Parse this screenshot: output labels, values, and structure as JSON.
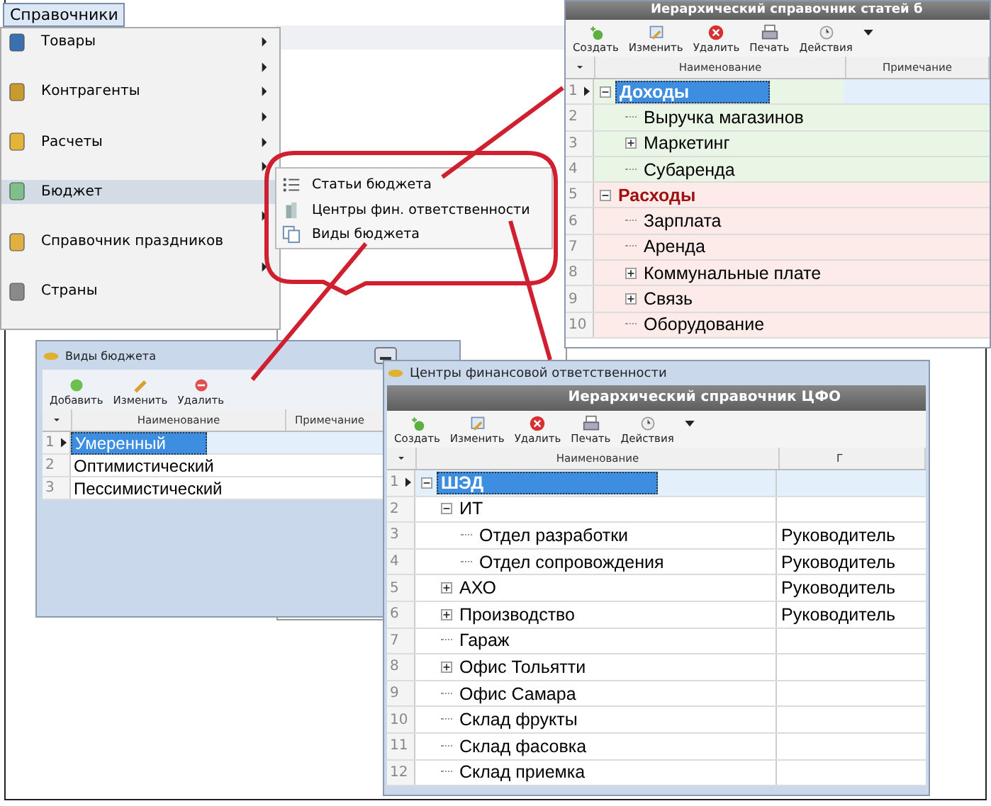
{
  "menu_button": {
    "label": "Справочники"
  },
  "menu": {
    "items": [
      {
        "kind": "goods",
        "label": "Товары",
        "submenu": true,
        "selected": false
      },
      {
        "kind": "blank",
        "submenu": true,
        "selected": false
      },
      {
        "kind": "partners",
        "label": "Контрагенты",
        "submenu": true,
        "selected": false
      },
      {
        "kind": "blank",
        "submenu": true,
        "selected": false
      },
      {
        "kind": "payments",
        "label": "Расчеты",
        "submenu": true,
        "selected": false
      },
      {
        "kind": "blank",
        "submenu": true,
        "selected": false
      },
      {
        "kind": "budget",
        "label": "Бюджет",
        "submenu": false,
        "selected": true
      },
      {
        "kind": "blank",
        "submenu": true,
        "selected": false
      },
      {
        "kind": "holidays",
        "label": "Справочник праздников",
        "submenu": false,
        "selected": false
      },
      {
        "kind": "blank",
        "submenu": true,
        "selected": false
      },
      {
        "kind": "countries",
        "label": "Страны",
        "submenu": false,
        "selected": false
      }
    ]
  },
  "submenu": {
    "items": [
      {
        "kind": "list",
        "label": "Статьи бюджета"
      },
      {
        "kind": "building",
        "label": "Центры фин. ответственности"
      },
      {
        "kind": "pages",
        "label": "Виды бюджета"
      }
    ]
  },
  "articles_window": {
    "title": "Иерархический справочник статей б",
    "toolbar": [
      {
        "kind": "add",
        "label": "Создать"
      },
      {
        "kind": "edit",
        "label": "Изменить"
      },
      {
        "kind": "delete",
        "label": "Удалить"
      },
      {
        "kind": "print",
        "label": "Печать"
      },
      {
        "kind": "actions",
        "label": "Действия"
      }
    ],
    "columns": [
      "Наименование",
      "Примечание"
    ],
    "rows": [
      {
        "num": "1",
        "name": "Доходы",
        "color": "#e9f6e6",
        "selected": true,
        "expanded": true,
        "children": [
          {
            "num": "2",
            "name": "Выручка магазинов",
            "color": "#e9f6e6",
            "selected": false
          },
          {
            "num": "3",
            "name": "Маркетинг",
            "color": "#e9f6e6",
            "selected": false,
            "expanded": false
          },
          {
            "num": "4",
            "name": "Субаренда",
            "color": "#e9f6e6",
            "selected": false
          }
        ]
      },
      {
        "num": "5",
        "name": "Расходы",
        "color": "#fcebe8",
        "selected": false,
        "expanded": true,
        "children": [
          {
            "num": "6",
            "name": "Зарплата",
            "color": "#fcebe8",
            "selected": false
          },
          {
            "num": "7",
            "name": "Аренда",
            "color": "#fcebe8",
            "selected": false
          },
          {
            "num": "8",
            "name": "Коммунальные плате",
            "color": "#fcebe8",
            "selected": false,
            "expanded": false
          },
          {
            "num": "9",
            "name": "Связь",
            "color": "#fcebe8",
            "selected": false,
            "expanded": false
          },
          {
            "num": "10",
            "name": "Оборудование",
            "color": "#fcebe8",
            "selected": false
          }
        ]
      }
    ]
  },
  "budget_types_window": {
    "title": "Виды бюджета",
    "toolbar": [
      {
        "kind": "add",
        "label": "Добавить"
      },
      {
        "kind": "edit",
        "label": "Изменить"
      },
      {
        "kind": "delete",
        "label": "Удалить"
      }
    ],
    "columns": [
      "Наименование",
      "Примечание"
    ],
    "rows": [
      {
        "num": "1",
        "name": "Умеренный",
        "selected": true
      },
      {
        "num": "2",
        "name": "Оптимистический",
        "selected": false
      },
      {
        "num": "3",
        "name": "Пессимистический",
        "selected": false
      }
    ]
  },
  "cfo_window": {
    "title": "Центры финансовой ответственности",
    "heading": "Иерархический справочник ЦФО",
    "toolbar": [
      {
        "kind": "add",
        "label": "Создать"
      },
      {
        "kind": "edit",
        "label": "Изменить"
      },
      {
        "kind": "delete",
        "label": "Удалить"
      },
      {
        "kind": "print",
        "label": "Печать"
      },
      {
        "kind": "actions",
        "label": "Действия"
      }
    ],
    "columns": [
      "Наименование",
      "Г"
    ],
    "rows": [
      {
        "num": "1",
        "name": "ШЭД",
        "selected": true,
        "expanded": true,
        "children": [
          {
            "num": "2",
            "name": "ИТ",
            "selected": false,
            "expanded": true,
            "children": [
              {
                "num": "3",
                "name": "Отдел разработки",
                "column_2": "Руководитель",
                "selected": false
              },
              {
                "num": "4",
                "name": "Отдел сопровождения",
                "column_2": "Руководитель",
                "selected": false
              }
            ]
          },
          {
            "num": "5",
            "name": "АХО",
            "column_2": "Руководитель",
            "selected": false,
            "expanded": false
          },
          {
            "num": "6",
            "name": "Производство",
            "column_2": "Руководитель",
            "selected": false,
            "expanded": false
          },
          {
            "num": "7",
            "name": "Гараж",
            "selected": false
          },
          {
            "num": "8",
            "name": "Офис Тольятти",
            "selected": false,
            "expanded": false
          },
          {
            "num": "9",
            "name": "Офис Самара",
            "selected": false
          },
          {
            "num": "10",
            "name": "Склад фрукты",
            "selected": false
          },
          {
            "num": "11",
            "name": "Склад фасовка",
            "selected": false
          },
          {
            "num": "12",
            "name": "Склад приемка",
            "selected": false
          }
        ]
      }
    ]
  }
}
